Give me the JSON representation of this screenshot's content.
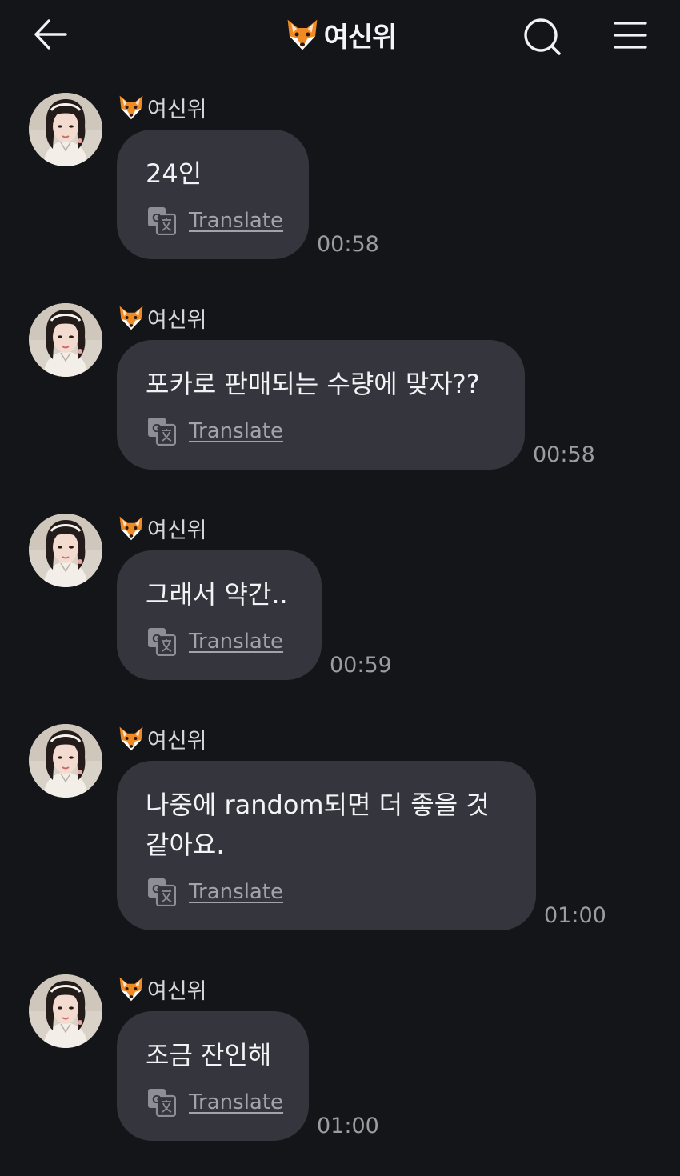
{
  "header": {
    "back_icon": "arrow-left-icon",
    "title_emoji_icon": "fox-face-icon",
    "title": "여신위",
    "search_icon": "search-icon",
    "menu_icon": "hamburger-menu-icon"
  },
  "translate_label": "Translate",
  "colors": {
    "background": "#141519",
    "bubble": "#35353d",
    "text": "#f3f3f5",
    "muted": "#9c9ca4"
  },
  "messages": [
    {
      "sender": "여신위",
      "text": "24인",
      "translate": "Translate",
      "time": "00:58"
    },
    {
      "sender": "여신위",
      "text": "포카로 판매되는 수량에 맞자??",
      "translate": "Translate",
      "time": "00:58"
    },
    {
      "sender": "여신위",
      "text": "그래서 약간..",
      "translate": "Translate",
      "time": "00:59"
    },
    {
      "sender": "여신위",
      "text": "나중에 random되면 더 좋을 것\n같아요.",
      "translate": "Translate",
      "time": "01:00"
    },
    {
      "sender": "여신위",
      "text": "조금 잔인해",
      "translate": "Translate",
      "time": "01:00"
    }
  ]
}
